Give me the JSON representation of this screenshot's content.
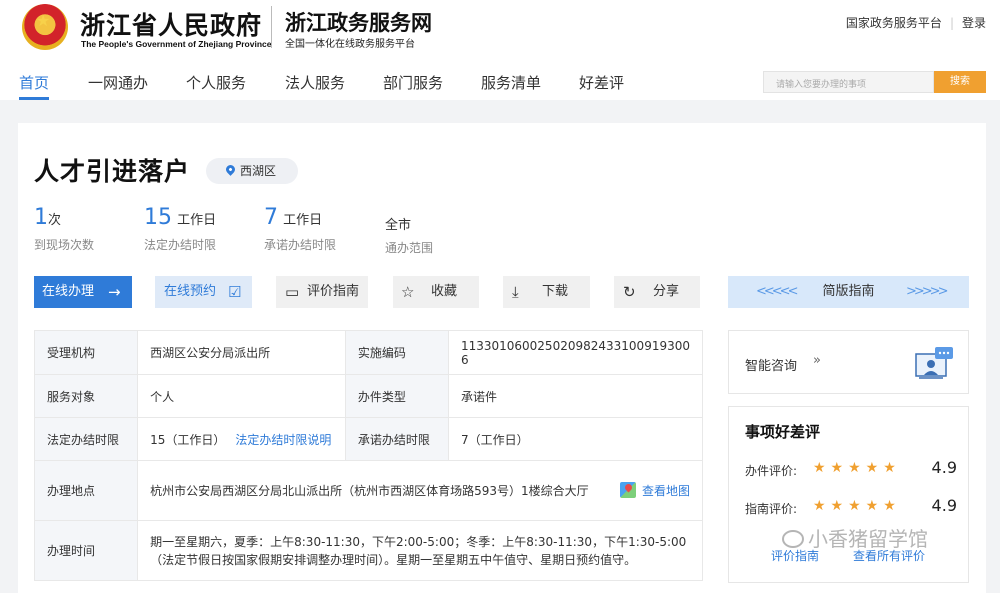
{
  "header": {
    "gov_title": "浙江省人民政府",
    "gov_subtitle": "The People's Government of Zhejiang Province",
    "site_title": "浙江政务服务网",
    "site_subtitle": "全国一体化在线政务服务平台",
    "top_links": [
      "国家政务服务平台",
      "登录"
    ]
  },
  "nav": {
    "items": [
      "首页",
      "一网通办",
      "个人服务",
      "法人服务",
      "部门服务",
      "服务清单",
      "好差评"
    ],
    "active": "首页"
  },
  "search": {
    "placeholder": "请输入您要办理的事项",
    "button": "搜索"
  },
  "item": {
    "title": "人才引进落户",
    "region": "西湖区",
    "stats": [
      {
        "num": "1",
        "unit": "次",
        "label": "到现场次数"
      },
      {
        "num": "15",
        "unit": "工作日",
        "label": "法定办结时限"
      },
      {
        "num": "7",
        "unit": "工作日",
        "label": "承诺办结时限"
      },
      {
        "num": "",
        "unit": "全市",
        "label": "通办范围"
      }
    ]
  },
  "actions": {
    "online": "在线办理",
    "reserve": "在线预约",
    "guide_eval": "评价指南",
    "favorite": "收藏",
    "download": "下载",
    "share": "分享",
    "simple": "简版指南"
  },
  "table": {
    "org_label": "受理机构",
    "org": "西湖区公安分局派出所",
    "code_label": "实施编码",
    "code": "113301060025020982433100919300​6",
    "target_label": "服务对象",
    "target": "个人",
    "type_label": "办件类型",
    "type": "承诺件",
    "legal_label": "法定办结时限",
    "legal": "15（工作日）",
    "legal_link": "法定办结时限说明",
    "promise_label": "承诺办结时限",
    "promise": "7（工作日）",
    "place_label": "办理地点",
    "place": "杭州市公安局西湖区分局北山派出所（杭州市西湖区体育场路593号）1楼综合大厅",
    "map_link": "查看地图",
    "hours_label": "办理时间",
    "hours": "期一至星期六，夏季：上午8:30-11:30，下午2:00-5:00；冬季：上午8:30-11:30，下午1:30-5:00（法定节假日按国家假期安排调整办理时间）。星期一至星期五中午值守、星期日预约值守。"
  },
  "side": {
    "consult": "智能咨询",
    "rating_title": "事项好差评",
    "ratings": [
      {
        "label": "办件评价:",
        "score": "4.9",
        "stars": 5
      },
      {
        "label": "指南评价:",
        "score": "4.9",
        "stars": 5
      }
    ],
    "links": [
      "评价指南",
      "查看所有评价"
    ]
  },
  "watermark": "小香猪留学馆",
  "colors": {
    "accent": "#2f7bd8",
    "search_button": "#f0a030",
    "star": "#f0a030"
  }
}
